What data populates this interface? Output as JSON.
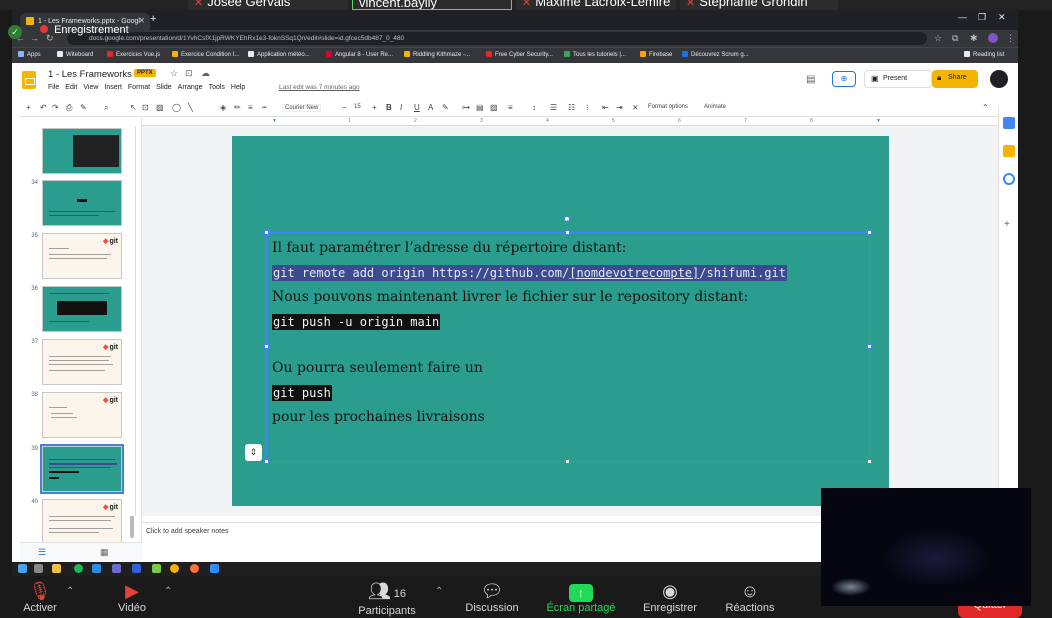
{
  "zoom_strip": {
    "participants": [
      "Josée Gervais",
      "vincent.baylly",
      "Maxime Lacroix-Lemire",
      "Stéphanie Grondin"
    ]
  },
  "recording": {
    "label": "Enregistrement"
  },
  "browser": {
    "tab_title": "1 - Les Frameworks.pptx - Googl",
    "url": "docs.google.com/presentation/d/1YvhCsfX1jpRWKYEhRx1e3-foknSSq1Qn/edit#slide=id.gfcec5db487_0_480",
    "bookmarks": [
      {
        "label": "Apps",
        "color": "#8ab4f8"
      },
      {
        "label": "Witeboard",
        "color": "#e8eaed"
      },
      {
        "label": "Exercices Vue.js",
        "color": "#d93025"
      },
      {
        "label": "Exercice Condition I...",
        "color": "#f4b400"
      },
      {
        "label": "Application météo...",
        "color": "#e8eaed"
      },
      {
        "label": "Angular 8 - User Re...",
        "color": "#dd0031"
      },
      {
        "label": "Riddling Kithmaze -...",
        "color": "#f4b400"
      },
      {
        "label": "Free Cyber Security...",
        "color": "#d93025"
      },
      {
        "label": "Tous les tutoriels |...",
        "color": "#34a853"
      },
      {
        "label": "Firebase",
        "color": "#ffa000"
      },
      {
        "label": "Découvrez Scrum g...",
        "color": "#1a73e8"
      }
    ],
    "reading_list": "Reading list"
  },
  "slides": {
    "doc_title": "1 - Les Frameworks",
    "badge": "PPTX",
    "menus": [
      "File",
      "Edit",
      "View",
      "Insert",
      "Format",
      "Slide",
      "Arrange",
      "Tools",
      "Help"
    ],
    "last_edit": "Last edit was 7 minutes ago",
    "present_label": "Present",
    "share_label": "Share",
    "toolbar": {
      "font": "Courier New",
      "font_size": "15",
      "format_options": "Format options",
      "animate": "Animate"
    },
    "filmstrip": [
      {
        "num": "",
        "style": "teal"
      },
      {
        "num": "34",
        "style": "teal"
      },
      {
        "num": "35",
        "style": "light"
      },
      {
        "num": "36",
        "style": "teal"
      },
      {
        "num": "37",
        "style": "light"
      },
      {
        "num": "38",
        "style": "light"
      },
      {
        "num": "39",
        "style": "teal"
      },
      {
        "num": "40",
        "style": "light"
      }
    ],
    "ruler_marks": [
      "1",
      "2",
      "3",
      "4",
      "5",
      "6",
      "7",
      "8",
      "9"
    ],
    "slide_lines": {
      "line1": "Il faut paramétrer l’adresse du répertoire distant:",
      "code1_a": "git remote add origin https://github.com/",
      "code1_b": "[nomdevotrecompte]",
      "code1_c": "/shifumi.git",
      "line2": "Nous pouvons maintenant livrer le fichier sur le repository distant:",
      "code2": "git push -u origin main",
      "line3": "Ou pourra seulement faire un",
      "code3": "git push",
      "line4": "pour les prochaines livraisons"
    },
    "speaker_notes_placeholder": "Click to add speaker notes"
  },
  "zoom_controls": {
    "mute": "Activer",
    "video": "Vidéo",
    "participants": "Participants",
    "participants_count": "16",
    "chat": "Discussion",
    "share": "Écran partagé",
    "record": "Enregistrer",
    "reactions": "Réactions",
    "quit": "Quitter"
  }
}
